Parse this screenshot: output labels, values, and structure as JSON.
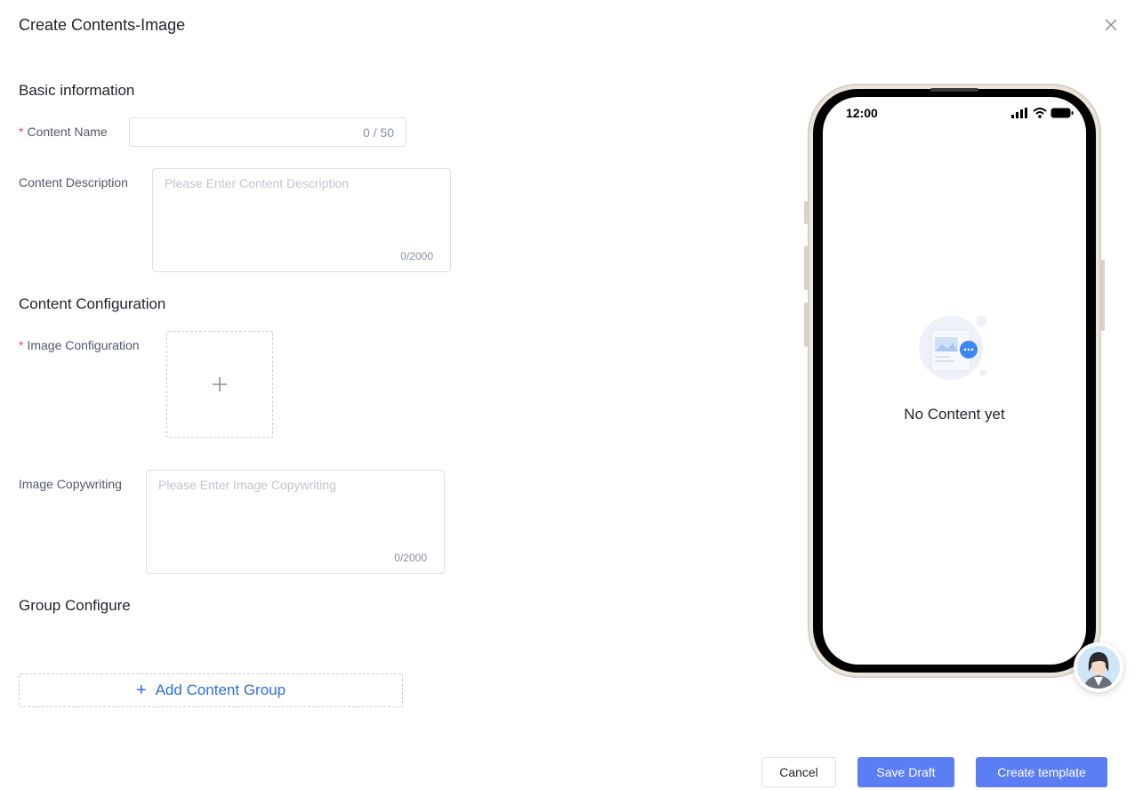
{
  "dialog": {
    "title": "Create Contents-Image"
  },
  "basic": {
    "section_title": "Basic information",
    "content_name_label": "Content Name",
    "content_name_count": "0 / 50",
    "description_label": "Content Description",
    "description_placeholder": "Please Enter Content Description",
    "description_count": "0/2000"
  },
  "config": {
    "section_title": "Content Configuration",
    "image_config_label": "Image Configuration",
    "copywriting_label": "Image Copywriting",
    "copywriting_placeholder": "Please Enter Image Copywriting",
    "copywriting_count": "0/2000"
  },
  "group": {
    "section_title": "Group Configure",
    "add_label": "Add Content Group"
  },
  "preview": {
    "status_time": "12:00",
    "empty_text": "No Content yet"
  },
  "footer": {
    "cancel_label": "Cancel",
    "save_draft_label": "Save Draft",
    "create_label": "Create template"
  },
  "colors": {
    "accent": "#5b7ef5",
    "link": "#2e6be6",
    "required": "#f53f3f"
  }
}
